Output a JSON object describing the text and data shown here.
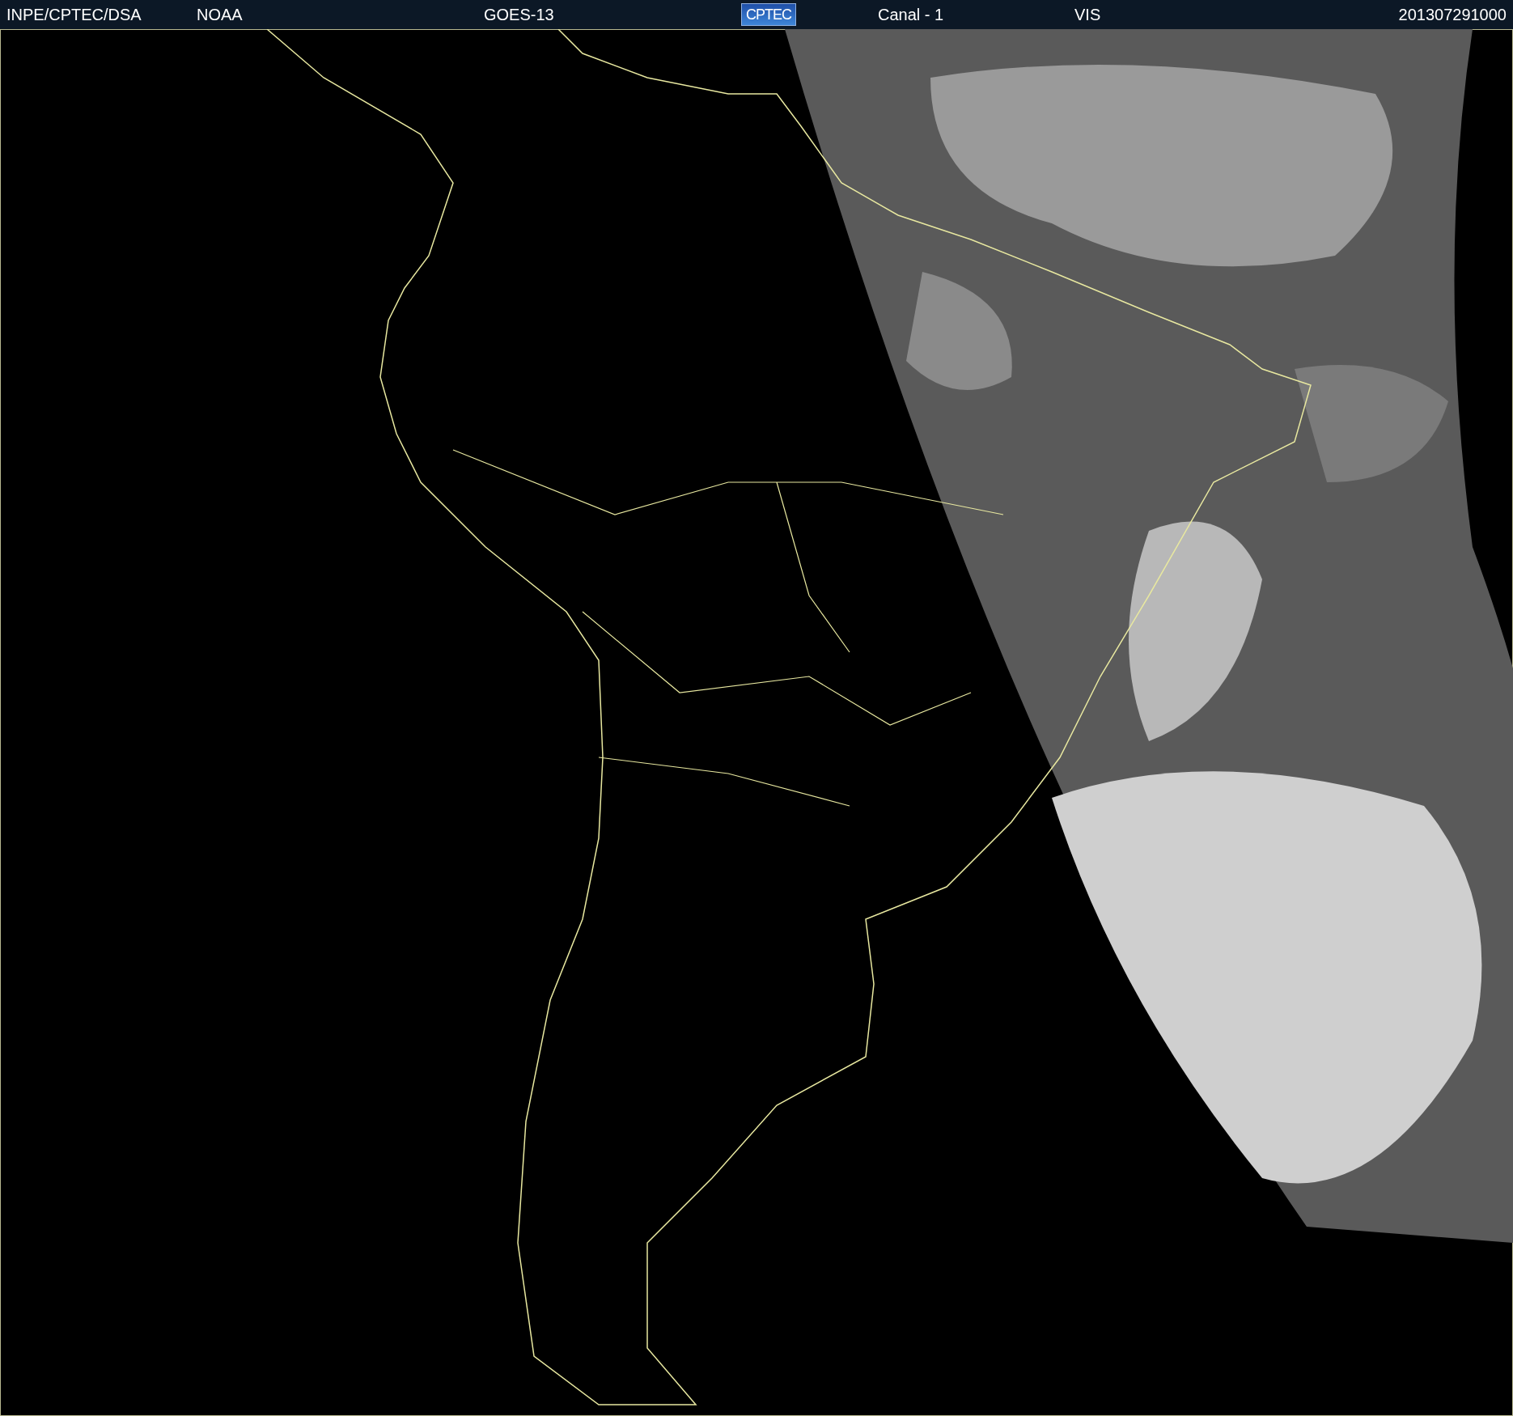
{
  "header": {
    "source": "INPE/CPTEC/DSA",
    "agency": "NOAA",
    "satellite": "GOES-13",
    "logo": "CPTEC",
    "channel": "Canal - 1",
    "band": "VIS",
    "timestamp": "201307291000"
  }
}
